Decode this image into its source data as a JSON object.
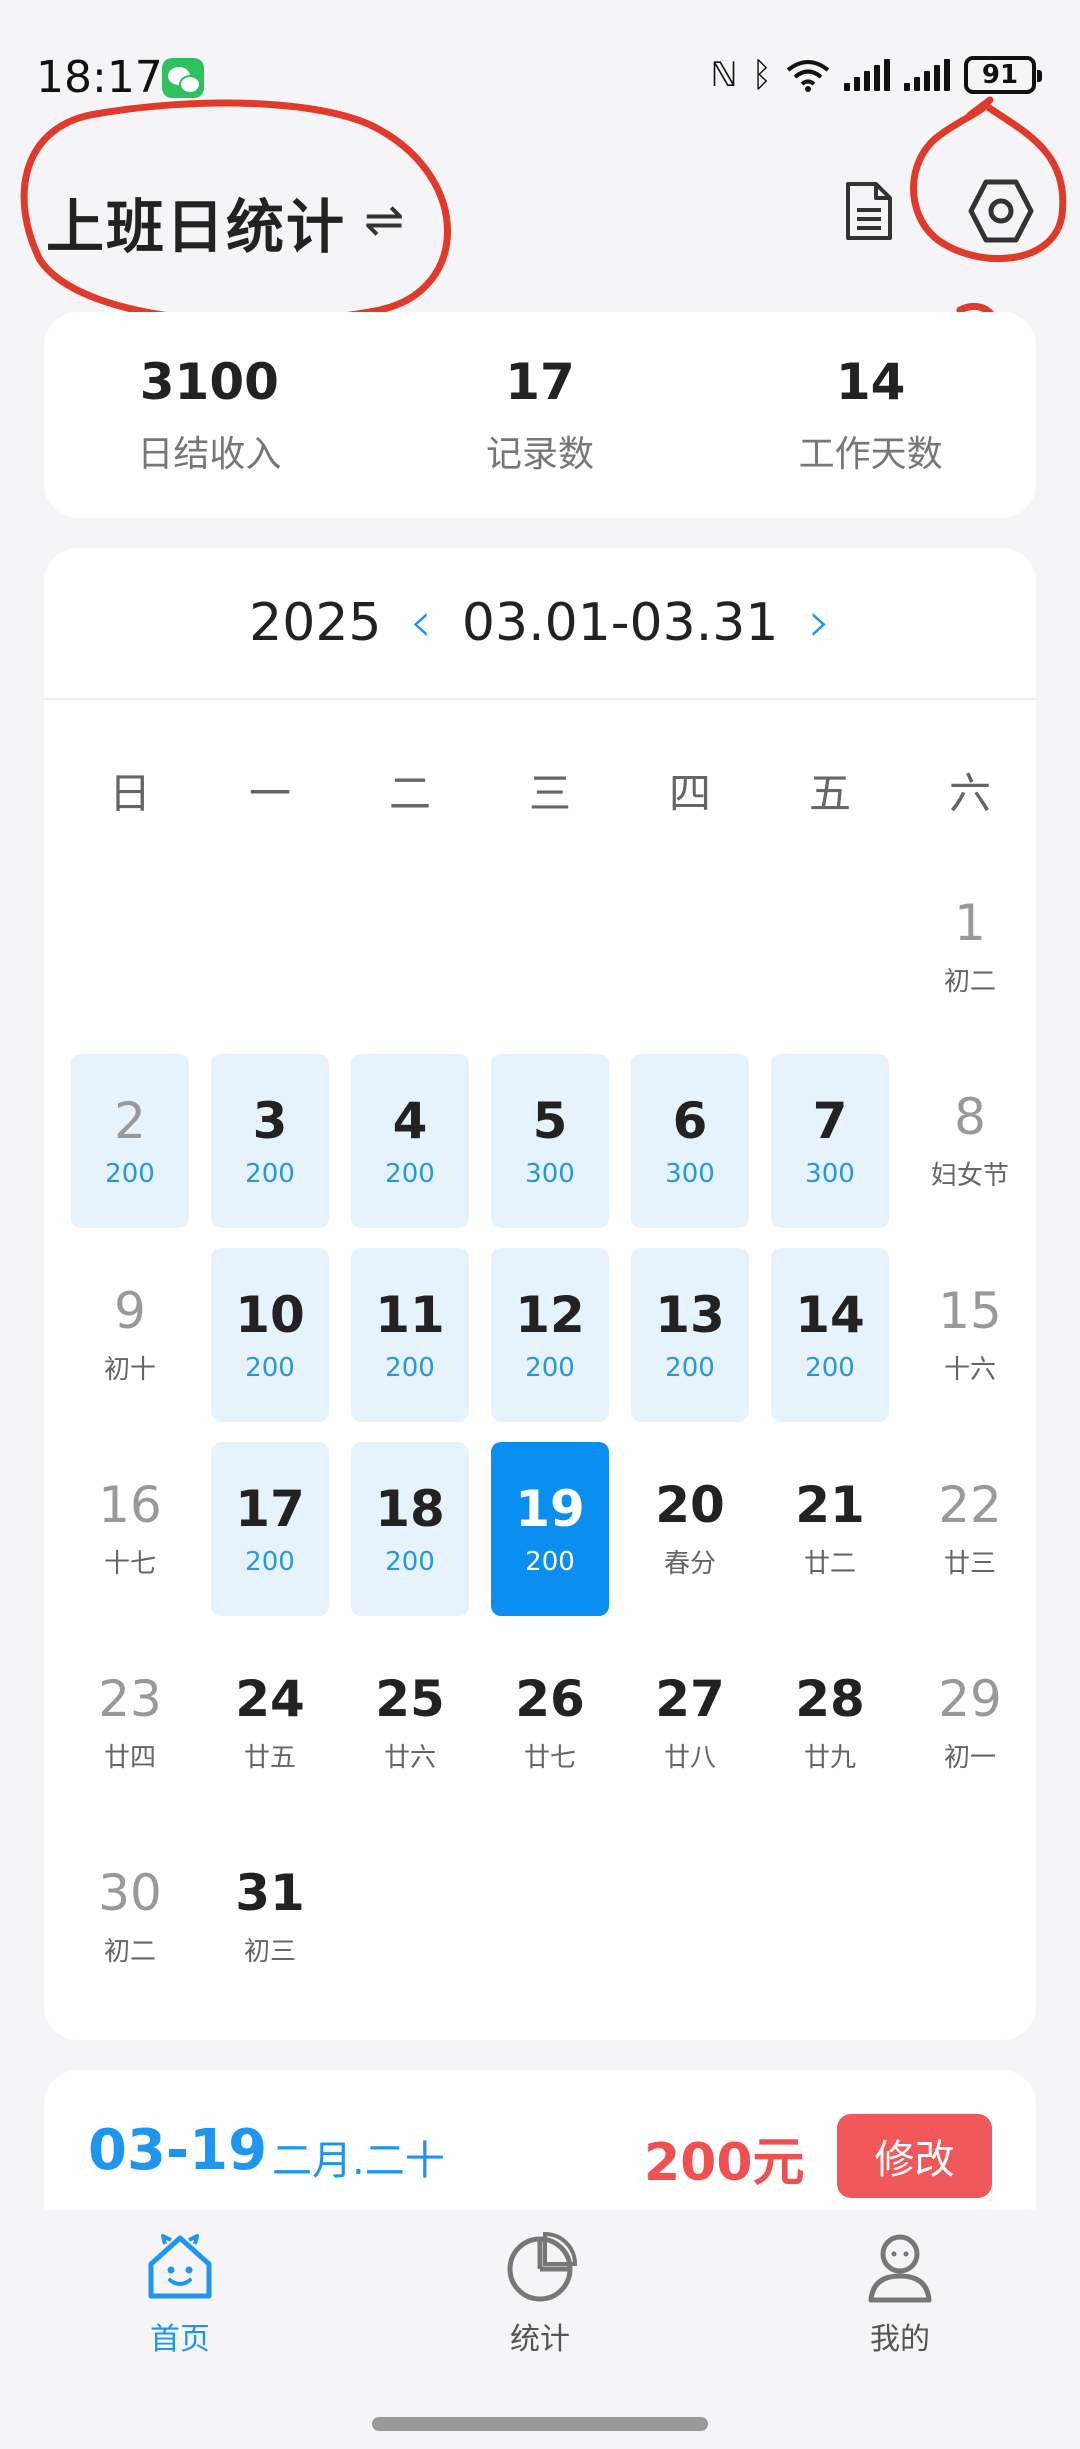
{
  "status_bar": {
    "time": "18:17",
    "battery": "91"
  },
  "header": {
    "title": "上班日统计"
  },
  "summary": [
    {
      "value": "3100",
      "label": "日结收入"
    },
    {
      "value": "17",
      "label": "记录数"
    },
    {
      "value": "14",
      "label": "工作天数"
    }
  ],
  "calendar": {
    "year": "2025",
    "range": "03.01-03.31",
    "weekdays": [
      "日",
      "一",
      "二",
      "三",
      "四",
      "五",
      "六"
    ],
    "leading_empty": 6,
    "days": [
      {
        "day": "1",
        "sub": "初二",
        "state": "none",
        "weekend": true
      },
      {
        "day": "2",
        "sub": "200",
        "state": "record",
        "weekend": true
      },
      {
        "day": "3",
        "sub": "200",
        "state": "record",
        "weekend": false
      },
      {
        "day": "4",
        "sub": "200",
        "state": "record",
        "weekend": false
      },
      {
        "day": "5",
        "sub": "300",
        "state": "record",
        "weekend": false
      },
      {
        "day": "6",
        "sub": "300",
        "state": "record",
        "weekend": false
      },
      {
        "day": "7",
        "sub": "300",
        "state": "record",
        "weekend": false
      },
      {
        "day": "8",
        "sub": "妇女节",
        "state": "none",
        "weekend": true
      },
      {
        "day": "9",
        "sub": "初十",
        "state": "none",
        "weekend": true
      },
      {
        "day": "10",
        "sub": "200",
        "state": "record",
        "weekend": false
      },
      {
        "day": "11",
        "sub": "200",
        "state": "record",
        "weekend": false
      },
      {
        "day": "12",
        "sub": "200",
        "state": "record",
        "weekend": false
      },
      {
        "day": "13",
        "sub": "200",
        "state": "record",
        "weekend": false
      },
      {
        "day": "14",
        "sub": "200",
        "state": "record",
        "weekend": false
      },
      {
        "day": "15",
        "sub": "十六",
        "state": "none",
        "weekend": true
      },
      {
        "day": "16",
        "sub": "十七",
        "state": "none",
        "weekend": true
      },
      {
        "day": "17",
        "sub": "200",
        "state": "record",
        "weekend": false
      },
      {
        "day": "18",
        "sub": "200",
        "state": "record",
        "weekend": false
      },
      {
        "day": "19",
        "sub": "200",
        "state": "selected",
        "weekend": false
      },
      {
        "day": "20",
        "sub": "春分",
        "state": "none",
        "weekend": false
      },
      {
        "day": "21",
        "sub": "廿二",
        "state": "none",
        "weekend": false
      },
      {
        "day": "22",
        "sub": "廿三",
        "state": "none",
        "weekend": true
      },
      {
        "day": "23",
        "sub": "廿四",
        "state": "none",
        "weekend": true
      },
      {
        "day": "24",
        "sub": "廿五",
        "state": "none",
        "weekend": false
      },
      {
        "day": "25",
        "sub": "廿六",
        "state": "none",
        "weekend": false
      },
      {
        "day": "26",
        "sub": "廿七",
        "state": "none",
        "weekend": false
      },
      {
        "day": "27",
        "sub": "廿八",
        "state": "none",
        "weekend": false
      },
      {
        "day": "28",
        "sub": "廿九",
        "state": "none",
        "weekend": false
      },
      {
        "day": "29",
        "sub": "初一",
        "state": "none",
        "weekend": true
      },
      {
        "day": "30",
        "sub": "初二",
        "state": "none",
        "weekend": true
      },
      {
        "day": "31",
        "sub": "初三",
        "state": "none",
        "weekend": false
      }
    ]
  },
  "detail": {
    "date": "03-19",
    "lunar": "二月.二十",
    "amount": "200元",
    "edit_label": "修改"
  },
  "tabs": [
    {
      "label": "首页",
      "icon": "home-icon",
      "active": true
    },
    {
      "label": "统计",
      "icon": "pie-chart-icon",
      "active": false
    },
    {
      "label": "我的",
      "icon": "user-icon",
      "active": false
    }
  ],
  "annotation": {
    "label": "2"
  },
  "colors": {
    "accent": "#1e96f0",
    "selected": "#0a8ff0",
    "record_bg": "#e6f3fd",
    "danger": "#f2585a",
    "annotation": "#e03a2a"
  }
}
